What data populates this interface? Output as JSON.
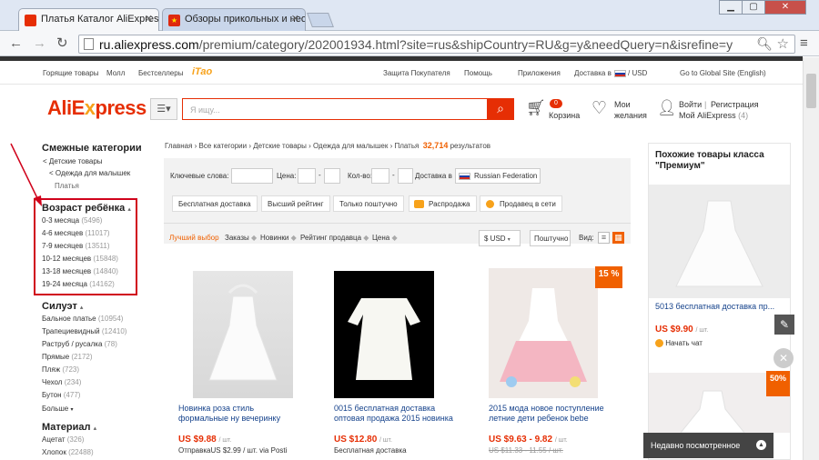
{
  "browser": {
    "tabs": [
      {
        "label": "Платья Каталог AliExpress,",
        "icon": "aliexpress-favicon"
      },
      {
        "label": "Обзоры прикольных и необ",
        "icon": "china-flag-favicon"
      }
    ],
    "address": {
      "domain": "ru.aliexpress.com",
      "path": "/premium/category/202001934.html?site=rus&shipCountry=RU&g=y&needQuery=n&isrefine=y"
    }
  },
  "topstrip": {
    "links": [
      "Горящие товары",
      "Молл",
      "Бестселлеры"
    ],
    "brand": "iTao",
    "right": [
      "Защита Покупателя",
      "Помощь",
      "Приложения",
      "Доставка в",
      "/ USD",
      "Go to Global Site (English)"
    ]
  },
  "header": {
    "logo_main": "AliE",
    "logo_x": "x",
    "logo_rest": "press",
    "search_placeholder": "Я ищу...",
    "cart_count": "0",
    "cart_label": "Корзина",
    "wish_line1": "Мои",
    "wish_line2": "желания",
    "login": "Войти",
    "separator": "|",
    "register": "Регистрация",
    "account": "Мой AliExpress",
    "account_count": "(4)"
  },
  "sidebar": {
    "related_title": "Смежные категории",
    "related": [
      "< Детские товары",
      "< Одежда для малышек",
      "Платья"
    ],
    "age_title": "Возраст ребёнка",
    "age": [
      {
        "label": "0-3 месяца",
        "count": "(5496)"
      },
      {
        "label": "4-6 месяцев",
        "count": "(11017)"
      },
      {
        "label": "7-9 месяцев",
        "count": "(13511)"
      },
      {
        "label": "10-12 месяцев",
        "count": "(15848)"
      },
      {
        "label": "13-18 месяцев",
        "count": "(14840)"
      },
      {
        "label": "19-24 месяца",
        "count": "(14162)"
      }
    ],
    "silhouette_title": "Силуэт",
    "silhouette": [
      {
        "label": "Бальное платье",
        "count": "(10954)"
      },
      {
        "label": "Трапециевидный",
        "count": "(12410)"
      },
      {
        "label": "Раструб / русалка",
        "count": "(78)"
      },
      {
        "label": "Прямые",
        "count": "(2172)"
      },
      {
        "label": "Пляж",
        "count": "(723)"
      },
      {
        "label": "Чехол",
        "count": "(234)"
      },
      {
        "label": "Бутон",
        "count": "(477)"
      }
    ],
    "more": "Больше",
    "material_title": "Материал",
    "material": [
      {
        "label": "Ацетат",
        "count": "(326)"
      },
      {
        "label": "Хлопок",
        "count": "(22488)"
      }
    ]
  },
  "breadcrumb": {
    "path": "Главная › Все категории › Детские товары › Одежда для малышек › Платья",
    "count": "32,714",
    "suffix": "результатов"
  },
  "filters": {
    "keywords": "Ключевые слова:",
    "price": "Цена:",
    "qty": "Кол-во:",
    "dash": "-",
    "ship_to": "Доставка в",
    "country": "Russian Federation",
    "pills": [
      "Бесплатная доставка",
      "Высший рейтинг",
      "Только поштучно",
      "Распродажа",
      "Продавец в сети"
    ]
  },
  "sort": {
    "options": [
      "Лучший выбор",
      "Заказы",
      "Новинки",
      "Рейтинг продавца",
      "Цена"
    ],
    "currency": "$ USD",
    "unit": "Поштучно",
    "view": "Вид:"
  },
  "products": [
    {
      "title": "Новинка роза стиль формальные ну вечеринку",
      "price": "US $9.88",
      "unit": "/ шт.",
      "ship": "ОтправкаUS $2.99 / шт. via Posti",
      "badge": ""
    },
    {
      "title": "0015 бесплатная доставка оптовая продажа 2015 новинка",
      "price": "US $12.80",
      "unit": "/ шт.",
      "ship": "Бесплатная доставка",
      "badge": ""
    },
    {
      "title": "2015 мода новое поступление летние дети ребенок bebe",
      "price": "US $9.63 - 9.82",
      "unit": "/ шт.",
      "ship": "US $11.33 - 11.55 / шт.",
      "badge": "15 %"
    }
  ],
  "right": {
    "title": "Похожие товары класса \"Премиум\"",
    "item_title": "5013 бесплатная доставка пр...",
    "item_price": "US $9.90",
    "item_unit": "/ шт.",
    "chat": "Начать чат",
    "badge": "50%",
    "recent": "Недавно посмотренное"
  },
  "colors": {
    "accent": "#e62e04",
    "link": "#15428b",
    "count": "#f06000",
    "highlight_box": "#d0021b"
  }
}
